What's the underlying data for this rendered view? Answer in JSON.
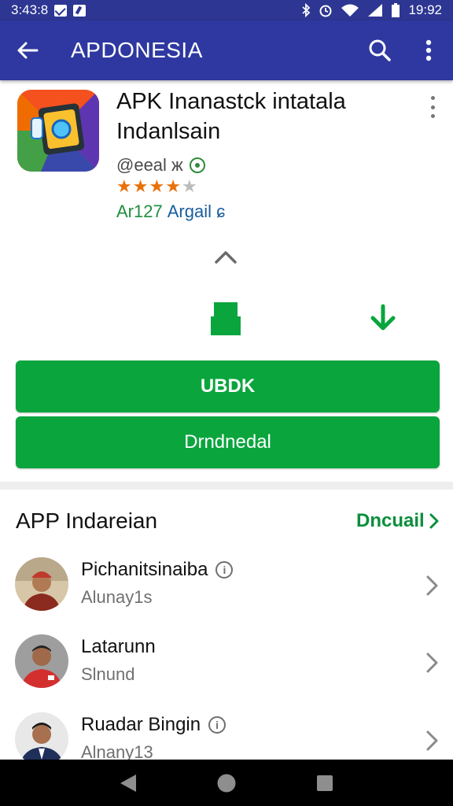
{
  "status_bar": {
    "time_left": "3:43:8",
    "time_right": "19:92"
  },
  "app_bar": {
    "title": "APDONESIA",
    "back_icon": "arrow-left-icon",
    "search_icon": "search-icon",
    "more_icon": "more-vert-icon"
  },
  "app": {
    "title_line1": "APK Inanastck intatala",
    "title_line2": "Indanlsain",
    "developer": "@eeal ж",
    "rating": 4,
    "rating_max": 5,
    "size": "Ar127",
    "category": "Argail ɕ"
  },
  "buttons": {
    "primary_label": "UBDK",
    "secondary_label": "Drndnedal"
  },
  "section": {
    "title": "APP Indareian",
    "link": "Dncuail"
  },
  "list": [
    {
      "name": "Pichanitsinaiba",
      "sub": "Alunay1s",
      "has_info": true
    },
    {
      "name": "Latarunn",
      "sub": "Slnund",
      "has_info": false
    },
    {
      "name": "Ruadar Bingin",
      "sub": "Alnany13",
      "has_info": true
    }
  ],
  "colors": {
    "app_bar": "#2e38a0",
    "status_bar": "#2d3692",
    "accent_green": "#0aa53d",
    "star": "#e8710a"
  }
}
